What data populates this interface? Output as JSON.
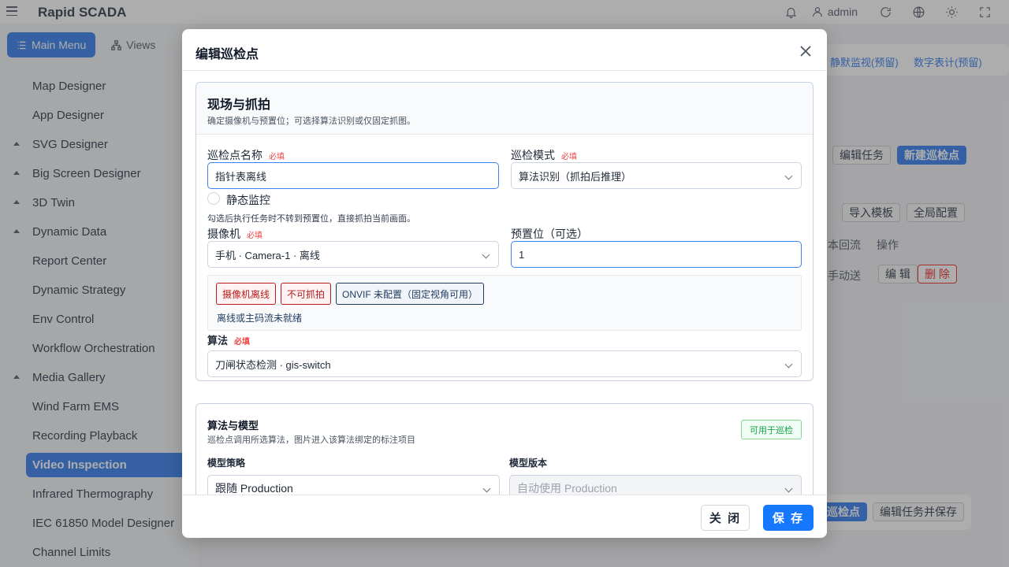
{
  "app": {
    "title": "Rapid SCADA",
    "user": "admin"
  },
  "sidebar": {
    "tabs": [
      {
        "label": "Main Menu",
        "icon": "list-icon",
        "active": true
      },
      {
        "label": "Views",
        "icon": "hierarchy-icon",
        "active": false
      }
    ],
    "items": [
      {
        "label": "Map Designer",
        "expandable": false
      },
      {
        "label": "App Designer",
        "expandable": false
      },
      {
        "label": "SVG Designer",
        "expandable": true
      },
      {
        "label": "Big Screen Designer",
        "expandable": true
      },
      {
        "label": "3D Twin",
        "expandable": true
      },
      {
        "label": "Dynamic Data",
        "expandable": true
      },
      {
        "label": "Report Center",
        "expandable": false
      },
      {
        "label": "Dynamic Strategy",
        "expandable": false
      },
      {
        "label": "Env Control",
        "expandable": false
      },
      {
        "label": "Workflow Orchestration",
        "expandable": false
      },
      {
        "label": "Media Gallery",
        "expandable": true
      },
      {
        "label": "Wind Farm EMS",
        "expandable": false
      },
      {
        "label": "Recording Playback",
        "expandable": false
      },
      {
        "label": "Video Inspection",
        "expandable": false,
        "active": true
      },
      {
        "label": "Infrared Thermography",
        "expandable": false
      },
      {
        "label": "IEC 61850 Model Designer",
        "expandable": false
      },
      {
        "label": "Channel Limits",
        "expandable": false
      }
    ]
  },
  "background": {
    "links": [
      "静默监视(预留)",
      "数字表计(预留)"
    ],
    "buttons_top": [
      "编辑任务",
      "新建巡检点"
    ],
    "buttons_mid": [
      "导入模板",
      "全局配置"
    ],
    "col_headers": [
      "本回流",
      "操作"
    ],
    "row_text": "手动送",
    "row_edit": "编 辑",
    "row_delete": "删 除",
    "bottom_buttons": [
      "巡检点",
      "编辑任务并保存"
    ]
  },
  "dialog": {
    "title": "编辑巡检点",
    "section1": {
      "title": "现场与抓拍",
      "desc": "确定摄像机与预置位；可选择算法识别或仅固定抓图。",
      "name_label": "巡检点名称",
      "required": "必填",
      "name_value": "指针表离线",
      "mode_label": "巡检模式",
      "mode_value": "算法识别（抓拍后推理）",
      "static_label": "静态监控",
      "static_hint": "勾选后执行任务时不转到预置位，直接抓拍当前画面。",
      "camera_label": "摄像机",
      "camera_value": "手机 · Camera-1 · 离线",
      "preset_label": "预置位（可选）",
      "preset_value": "1",
      "tags": [
        "摄像机离线",
        "不可抓拍",
        "ONVIF 未配置（固定视角可用）"
      ],
      "status_note": "离线或主码流未就绪",
      "algo_label": "算法",
      "algo_value": "刀闸状态检测 · gis-switch"
    },
    "section2": {
      "title": "算法与模型",
      "desc": "巡检点调用所选算法，图片进入该算法绑定的标注项目",
      "badge": "可用于巡检",
      "strategy_label": "模型策略",
      "strategy_value": "跟随 Production",
      "version_label": "模型版本",
      "version_value": "自动使用 Production"
    },
    "buttons": {
      "close": "关 闭",
      "save": "保 存"
    }
  },
  "colors": {
    "primary": "#1677ff",
    "sidebar_active": "#4f8ff2",
    "danger": "#b91c1c",
    "success": "#16a34a"
  }
}
